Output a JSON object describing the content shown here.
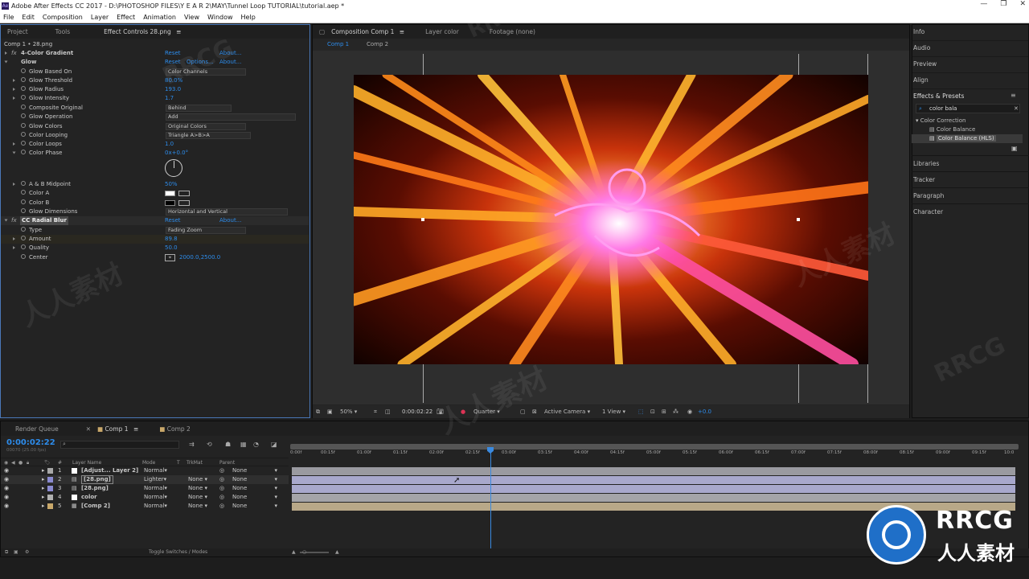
{
  "title": "Adobe After Effects CC 2017 - D:\\PHOTOSHOP FILES\\Y E A R 2\\MAY\\Tunnel Loop TUTORIAL\\tutorial.aep *",
  "menu": [
    "File",
    "Edit",
    "Composition",
    "Layer",
    "Effect",
    "Animation",
    "View",
    "Window",
    "Help"
  ],
  "left_panel": {
    "tabs": [
      "Project",
      "Tools",
      "Effect Controls 28.png"
    ],
    "header": "Comp 1 • 28.png",
    "effects": [
      {
        "name": "4-Color Gradient",
        "reset": "Reset",
        "about": "About..."
      },
      {
        "name": "Glow",
        "reset": "Reset",
        "options": "Options...",
        "about": "About..."
      }
    ],
    "glow": [
      {
        "label": "Glow Based On",
        "value": "Color Channels"
      },
      {
        "label": "Glow Threshold",
        "value": "80.0%"
      },
      {
        "label": "Glow Radius",
        "value": "193.0"
      },
      {
        "label": "Glow Intensity",
        "value": "1.7"
      },
      {
        "label": "Composite Original",
        "value": "Behind"
      },
      {
        "label": "Glow Operation",
        "value": "Add"
      },
      {
        "label": "Glow Colors",
        "value": "Original Colors"
      },
      {
        "label": "Color Looping",
        "value": "Triangle A>B>A"
      },
      {
        "label": "Color Loops",
        "value": "1.0"
      },
      {
        "label": "Color Phase",
        "value": "0x+0.0°"
      },
      {
        "label": "A & B Midpoint",
        "value": "50%"
      },
      {
        "label": "Color A",
        "value": ""
      },
      {
        "label": "Color B",
        "value": ""
      },
      {
        "label": "Glow Dimensions",
        "value": "Horizontal and Vertical"
      }
    ],
    "radial": {
      "name": "CC Radial Blur",
      "reset": "Reset",
      "about": "About...",
      "params": [
        {
          "label": "Type",
          "value": "Fading Zoom"
        },
        {
          "label": "Amount",
          "value": "89.8"
        },
        {
          "label": "Quality",
          "value": "50.0"
        },
        {
          "label": "Center",
          "value": "2000.0,2500.0"
        }
      ]
    }
  },
  "viewer": {
    "tabs": [
      "Composition Comp 1",
      "Layer color",
      "Footage (none)"
    ],
    "subtabs": [
      "Comp 1",
      "Comp 2"
    ],
    "zoom": "50%",
    "timecode": "0:00:02:22",
    "resolution": "Quarter",
    "camera": "Active Camera",
    "views": "1 View",
    "exposure": "+0.0"
  },
  "right_panel": {
    "items": [
      "Info",
      "Audio",
      "Preview",
      "Align",
      "Effects & Presets"
    ],
    "search": "color bala",
    "folder": "Color Correction",
    "results": [
      "Color Balance",
      "Color Balance (HLS)"
    ],
    "bottom": [
      "Libraries",
      "Tracker",
      "Paragraph",
      "Character"
    ]
  },
  "timeline": {
    "tabs": [
      "Render Queue",
      "Comp 1",
      "Comp 2"
    ],
    "timecode": "0:00:02:22",
    "subcode": "00070 (25.00 fps)",
    "headers": [
      "#",
      "Layer Name",
      "Mode",
      "T",
      "TrkMat",
      "Parent"
    ],
    "ticks": [
      "0:00f",
      "00:15f",
      "01:00f",
      "01:15f",
      "02:00f",
      "02:15f",
      "03:00f",
      "03:15f",
      "04:00f",
      "04:15f",
      "05:00f",
      "05:15f",
      "06:00f",
      "06:15f",
      "07:00f",
      "07:15f",
      "08:00f",
      "08:15f",
      "09:00f",
      "09:15f",
      "10:0"
    ],
    "layers": [
      {
        "num": "1",
        "name": "[Adjust... Layer 2]",
        "mode": "Normal",
        "trkmat": "",
        "parent": "None",
        "color": "#a8a8a8"
      },
      {
        "num": "2",
        "name": "[28.png]",
        "mode": "Lighter",
        "trkmat": "None",
        "parent": "None",
        "color": "#8a8ad0"
      },
      {
        "num": "3",
        "name": "[28.png]",
        "mode": "Normal",
        "trkmat": "None",
        "parent": "None",
        "color": "#8a8ad0"
      },
      {
        "num": "4",
        "name": "color",
        "mode": "Normal",
        "trkmat": "None",
        "parent": "None",
        "color": "#b0b0b0"
      },
      {
        "num": "5",
        "name": "[Comp 2]",
        "mode": "Normal",
        "trkmat": "None",
        "parent": "None",
        "color": "#c9a86a"
      }
    ],
    "footer": "Toggle Switches / Modes"
  },
  "watermark": {
    "brand": "RRCG",
    "cn": "人人素材"
  }
}
